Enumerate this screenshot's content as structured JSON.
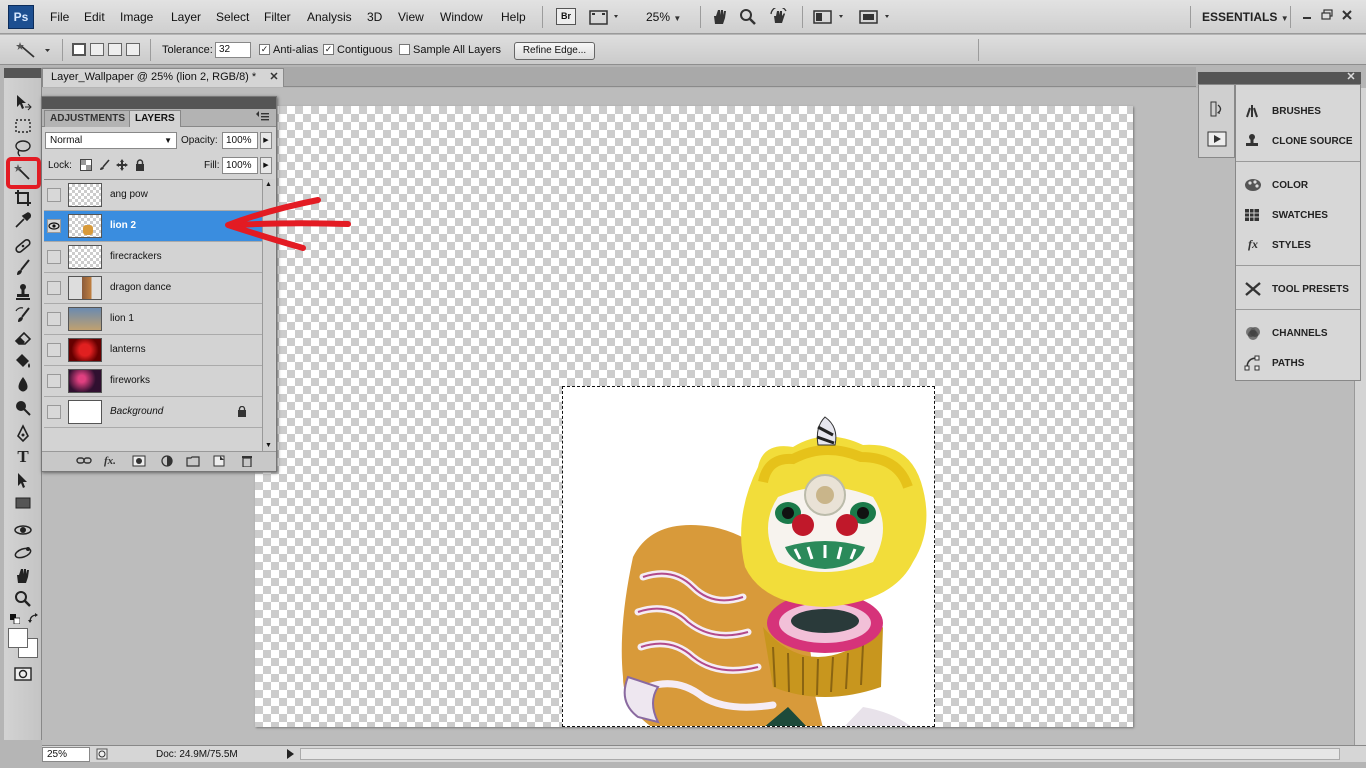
{
  "app": {
    "logo": "Ps"
  },
  "menu": [
    "File",
    "Edit",
    "Image",
    "Layer",
    "Select",
    "Filter",
    "Analysis",
    "3D",
    "View",
    "Window",
    "Help"
  ],
  "menubar": {
    "bridge_label": "Br",
    "zoom": "25%",
    "workspace": "ESSENTIALS"
  },
  "options": {
    "tolerance_label": "Tolerance:",
    "tolerance_value": "32",
    "anti_alias_label": "Anti-alias",
    "contiguous_label": "Contiguous",
    "sample_all_label": "Sample All Layers",
    "refine_label": "Refine Edge..."
  },
  "document": {
    "tab_title": "Layer_Wallpaper @ 25% (lion 2, RGB/8) *"
  },
  "layers_panel": {
    "tab_adjustments": "ADJUSTMENTS",
    "tab_layers": "LAYERS",
    "blend_mode": "Normal",
    "opacity_label": "Opacity:",
    "opacity_value": "100%",
    "lock_label": "Lock:",
    "fill_label": "Fill:",
    "fill_value": "100%",
    "layers": [
      {
        "name": "ang pow"
      },
      {
        "name": "lion 2"
      },
      {
        "name": "firecrackers"
      },
      {
        "name": "dragon dance"
      },
      {
        "name": "lion 1"
      },
      {
        "name": "lanterns"
      },
      {
        "name": "fireworks"
      },
      {
        "name": "Background"
      }
    ]
  },
  "dock": {
    "items": [
      "BRUSHES",
      "CLONE SOURCE",
      "COLOR",
      "SWATCHES",
      "STYLES",
      "TOOL PRESETS",
      "CHANNELS",
      "PATHS"
    ]
  },
  "status": {
    "zoom": "25%",
    "doc_size": "Doc: 24.9M/75.5M"
  },
  "colors": {
    "selection_highlight": "#3a8ddf",
    "annotation_red": "#e31b23",
    "menubar_bg": "#d8d8d8"
  }
}
